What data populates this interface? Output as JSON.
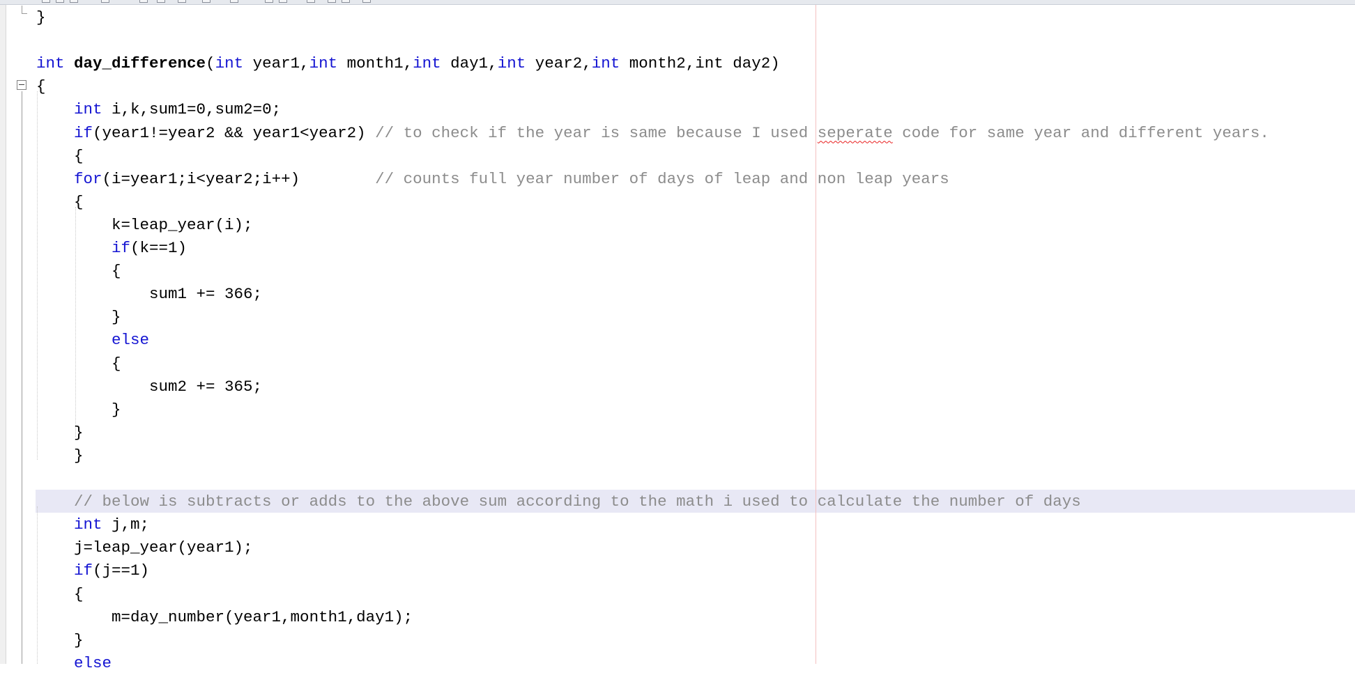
{
  "editor": {
    "lines": [
      {
        "text": "}"
      },
      {
        "text": ""
      },
      {
        "parts": [
          "int",
          " ",
          "day_difference",
          "(",
          "int",
          " year1,",
          "int",
          " month1,",
          "int",
          " day1,",
          "int",
          " year2,",
          "int",
          " month2,",
          "int",
          " day2)"
        ]
      },
      {
        "text": "{"
      },
      {
        "parts": [
          "    ",
          "int",
          " i,k,sum1=0,sum2=0;"
        ]
      },
      {
        "parts": [
          "    ",
          "if",
          "(year1!=year2 && year1<year2) ",
          "// to check if the year is same because I used ",
          "seperate",
          " code for same year and different years."
        ]
      },
      {
        "text": "    {"
      },
      {
        "parts": [
          "    ",
          "for",
          "(i=year1;i<year2;i++)        ",
          "// counts full year number of days of leap and non leap years"
        ]
      },
      {
        "text": "    {"
      },
      {
        "text": "        k=leap_year(i);"
      },
      {
        "parts": [
          "        ",
          "if",
          "(k==1)"
        ]
      },
      {
        "text": "        {"
      },
      {
        "text": "            sum1 += 366;"
      },
      {
        "text": "        }"
      },
      {
        "parts": [
          "        ",
          "else"
        ]
      },
      {
        "text": "        {"
      },
      {
        "text": "            sum2 += 365;"
      },
      {
        "text": "        }"
      },
      {
        "text": "    }"
      },
      {
        "text": "    }"
      },
      {
        "text": ""
      },
      {
        "parts": [
          "    ",
          "// below is subtracts or adds to the above sum according to the math i used to calculate the number of days"
        ]
      },
      {
        "parts": [
          "    ",
          "int",
          " j,m;"
        ]
      },
      {
        "text": "    j=leap_year(year1);"
      },
      {
        "parts": [
          "    ",
          "if",
          "(j==1)"
        ]
      },
      {
        "text": "    {"
      },
      {
        "text": "        m=day_number(year1,month1,day1);"
      },
      {
        "text": "    }"
      },
      {
        "parts": [
          "    ",
          "else"
        ]
      }
    ]
  },
  "colors": {
    "keyword": "#1414d2",
    "comment": "#8c8c8c",
    "text": "#000000",
    "current_line": "#e8e8f5",
    "edge_line": "#f3c0c0",
    "spell_error": "#e81b1b"
  },
  "icons": [
    "fold-collapse-icon",
    "fold-end-icon"
  ]
}
